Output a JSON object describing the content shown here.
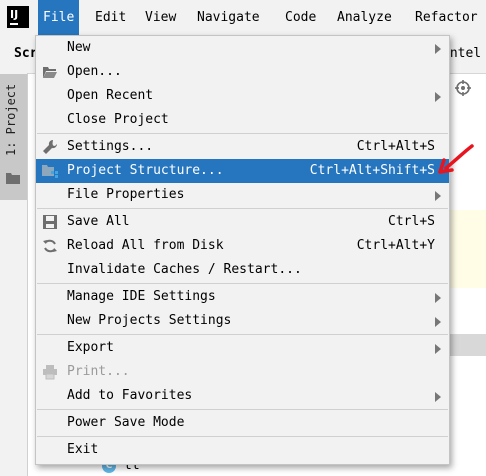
{
  "menubar": {
    "items": [
      {
        "label": "File",
        "active": true
      },
      {
        "label": "Edit"
      },
      {
        "label": "View"
      },
      {
        "label": "Navigate"
      },
      {
        "label": "Code"
      },
      {
        "label": "Analyze"
      },
      {
        "label": "Refactor"
      }
    ]
  },
  "toolbar": {
    "left_text": "Scr",
    "right_text": "Intel"
  },
  "side_panel": {
    "tab_label": "1: Project"
  },
  "tree": {
    "class_label": "tt"
  },
  "file_menu": {
    "items": [
      {
        "label": "New",
        "submenu": true,
        "icon": null
      },
      {
        "label": "Open...",
        "icon": "folder-open-icon"
      },
      {
        "label": "Open Recent",
        "submenu": true
      },
      {
        "label": "Close Project"
      },
      {
        "label": "Settings...",
        "shortcut": "Ctrl+Alt+S",
        "icon": "wrench-icon"
      },
      {
        "label": "Project Structure...",
        "shortcut": "Ctrl+Alt+Shift+S",
        "icon": "project-structure-icon",
        "selected": true
      },
      {
        "label": "File Properties",
        "submenu": true
      },
      {
        "label": "Save All",
        "shortcut": "Ctrl+S",
        "icon": "save-icon"
      },
      {
        "label": "Reload All from Disk",
        "shortcut": "Ctrl+Alt+Y",
        "icon": "reload-icon"
      },
      {
        "label": "Invalidate Caches / Restart..."
      },
      {
        "label": "Manage IDE Settings",
        "submenu": true
      },
      {
        "label": "New Projects Settings",
        "submenu": true
      },
      {
        "label": "Export",
        "submenu": true
      },
      {
        "label": "Print...",
        "icon": "printer-icon",
        "disabled": true
      },
      {
        "label": "Add to Favorites",
        "submenu": true
      },
      {
        "label": "Power Save Mode"
      },
      {
        "label": "Exit"
      }
    ]
  },
  "colors": {
    "accent": "#2675bf",
    "annotation": "#e8141e"
  }
}
